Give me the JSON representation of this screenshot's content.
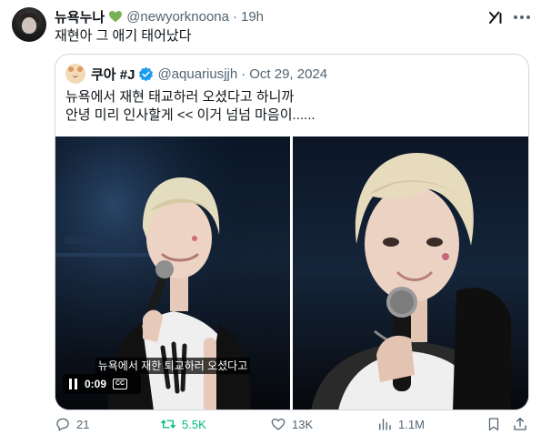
{
  "post": {
    "author_name": "뉴욕누나",
    "heart_emoji_color": "#78b159",
    "handle": "@newyorknoona",
    "separator": "·",
    "time": "19h",
    "text": "재현아 그 애기 태어났다"
  },
  "quote": {
    "author_name": "쿠아 #J",
    "verified_color": "#1d9bf0",
    "handle": "@aquariusjjh",
    "separator": "·",
    "date": "Oct 29, 2024",
    "lines": [
      "뉴욕에서 재현 태교하러 오셨다고 하니까",
      "안녕 미리 인사할게 << 이거 넘넘 마음이......"
    ],
    "video": {
      "caption": "뉴욕에서 재한 퇴교하러 오셨다고",
      "time": "0:09",
      "cc_label": "CC"
    }
  },
  "actions": {
    "replies": "21",
    "reposts": "5.5K",
    "likes": "13K",
    "views": "1.1M",
    "repost_color": "#00ba7c"
  },
  "icons": {
    "grok": "grok-icon",
    "more": "more-icon",
    "reply": "reply-icon",
    "repost": "repost-icon",
    "like": "heart-icon",
    "views": "views-icon",
    "bookmark": "bookmark-icon",
    "share": "share-icon",
    "pause": "pause-icon",
    "cc": "cc-icon"
  }
}
